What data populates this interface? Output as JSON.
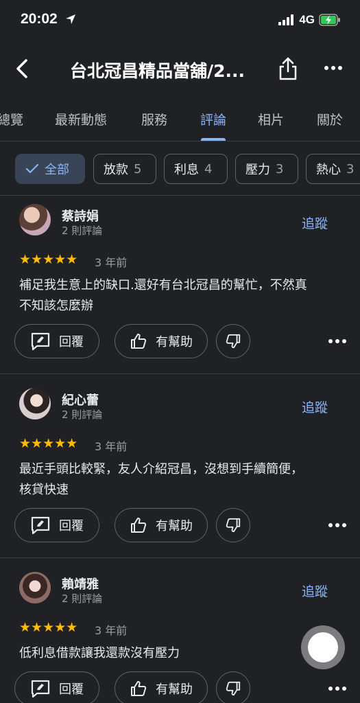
{
  "status_bar": {
    "time": "20:02",
    "network": "4G"
  },
  "header": {
    "title": "台北冠昌精品當舖/2..."
  },
  "tabs": [
    {
      "label": "總覽"
    },
    {
      "label": "最新動態"
    },
    {
      "label": "服務"
    },
    {
      "label": "評論",
      "active": true
    },
    {
      "label": "相片"
    },
    {
      "label": "關於"
    }
  ],
  "filters": [
    {
      "label": "全部",
      "count": "",
      "selected": true
    },
    {
      "label": "放款",
      "count": "5"
    },
    {
      "label": "利息",
      "count": "4"
    },
    {
      "label": "壓力",
      "count": "3"
    },
    {
      "label": "熱心",
      "count": "3"
    }
  ],
  "review_actions": {
    "reply": "回覆",
    "helpful": "有幫助",
    "follow": "追蹤"
  },
  "reviews": [
    {
      "name": "蔡詩娟",
      "review_count": "2 則評論",
      "rating": 5,
      "stars": "★★★★★",
      "time_ago": "3 年前",
      "text_lines": [
        "補足我生意上的缺口.還好有台北冠昌的幫忙，不然真",
        "不知該怎麼辦"
      ]
    },
    {
      "name": "紀心蕾",
      "review_count": "2 則評論",
      "rating": 5,
      "stars": "★★★★★",
      "time_ago": "3 年前",
      "text_lines": [
        "最近手頭比較緊，友人介紹冠昌，沒想到手續簡便，",
        "核貸快速"
      ]
    },
    {
      "name": "賴靖雅",
      "review_count": "2 則評論",
      "rating": 5,
      "stars": "★★★★★",
      "time_ago": "3 年前",
      "text_lines": [
        "低利息借款讓我還款沒有壓力"
      ]
    }
  ],
  "colors": {
    "accent": "#8ab4f8",
    "star": "#fbbc04",
    "background": "#202124"
  }
}
